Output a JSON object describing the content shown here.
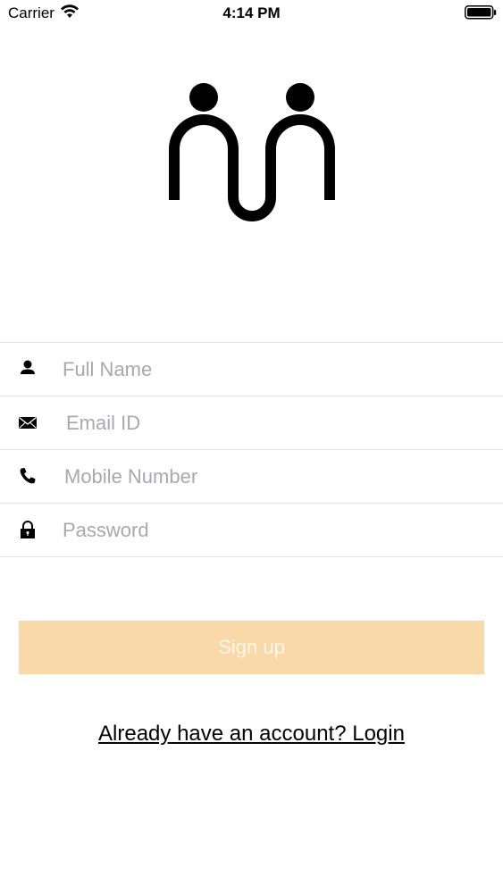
{
  "status_bar": {
    "carrier": "Carrier",
    "time": "4:14 PM",
    "wifi_icon": "wifi-icon",
    "battery_icon": "battery-full-icon"
  },
  "logo": {
    "icon": "two-people-connected-logo"
  },
  "form": {
    "full_name": {
      "placeholder": "Full Name",
      "value": "",
      "icon": "person-icon"
    },
    "email": {
      "placeholder": "Email ID",
      "value": "",
      "icon": "envelope-icon"
    },
    "mobile": {
      "placeholder": "Mobile Number",
      "value": "",
      "icon": "phone-icon"
    },
    "password": {
      "placeholder": "Password",
      "value": "",
      "icon": "lock-icon"
    }
  },
  "signup_button": {
    "label": "Sign up",
    "background_color": "#fad9a8"
  },
  "login_link": {
    "label": "Already have an account? Login"
  }
}
